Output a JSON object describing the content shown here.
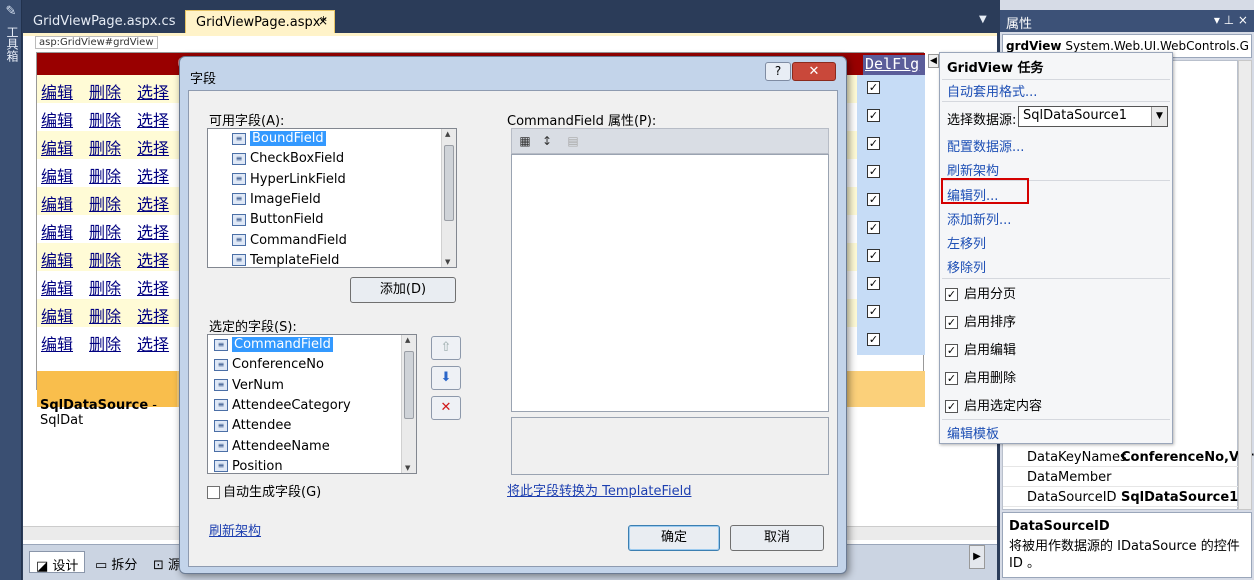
{
  "toolbox": {
    "label": "工具箱"
  },
  "tabs": [
    {
      "label": "GridViewPage.aspx.cs",
      "active": false
    },
    {
      "label": "GridViewPage.aspx*",
      "active": true,
      "close": "×"
    }
  ],
  "designer": {
    "tag_label": "asp:GridView#grdView",
    "grid": {
      "header_last": "DelFlg",
      "row_links": [
        "编辑",
        "删除",
        "选择"
      ],
      "row_count": 10,
      "checkbox_checked": "✓"
    },
    "sqlds_bar": {
      "name": "SqlDataSource",
      "suffix": " - SqlDat"
    },
    "bottom_tabs": [
      "设计",
      "拆分",
      "源"
    ]
  },
  "properties": {
    "title": "属性",
    "title_controls": "▾ ⊥ ×",
    "object": {
      "name": "grdView",
      "type": " System.Web.UI.WebControls.G"
    },
    "rows": [
      {
        "name": "DataKeyNames",
        "value": "ConferenceNo,Ver"
      },
      {
        "name": "DataMember",
        "value": ""
      },
      {
        "name": "DataSourceID",
        "value": "SqlDataSource1"
      }
    ],
    "desc_title": "DataSourceID",
    "desc_text": "将被用作数据源的 IDataSource 的控件 ID 。"
  },
  "smart_tag": {
    "title": "GridView 任务",
    "auto_format": "自动套用格式...",
    "choose_ds_label": "选择数据源:",
    "choose_ds_value": "SqlDataSource1",
    "links": [
      "配置数据源...",
      "刷新架构",
      "编辑列...",
      "添加新列...",
      "左移列",
      "移除列"
    ],
    "checks": [
      "启用分页",
      "启用排序",
      "启用编辑",
      "启用删除",
      "启用选定内容"
    ],
    "edit_templates": "编辑模板"
  },
  "dialog": {
    "title": "字段",
    "help": "?",
    "available_label": "可用字段(A):",
    "available_fields": [
      "BoundField",
      "CheckBoxField",
      "HyperLinkField",
      "ImageField",
      "ButtonField",
      "CommandField",
      "TemplateField"
    ],
    "add_button": "添加(D)",
    "selected_label": "选定的字段(S):",
    "selected_fields": [
      "CommandField",
      "ConferenceNo",
      "VerNum",
      "AttendeeCategory",
      "Attendee",
      "AttendeeName",
      "Position"
    ],
    "props_label": "CommandField 属性(P):",
    "convert_link": "将此字段转换为 TemplateField",
    "auto_generate": "自动生成字段(G)",
    "refresh_schema": "刷新架构",
    "ok": "确定",
    "cancel": "取消"
  }
}
